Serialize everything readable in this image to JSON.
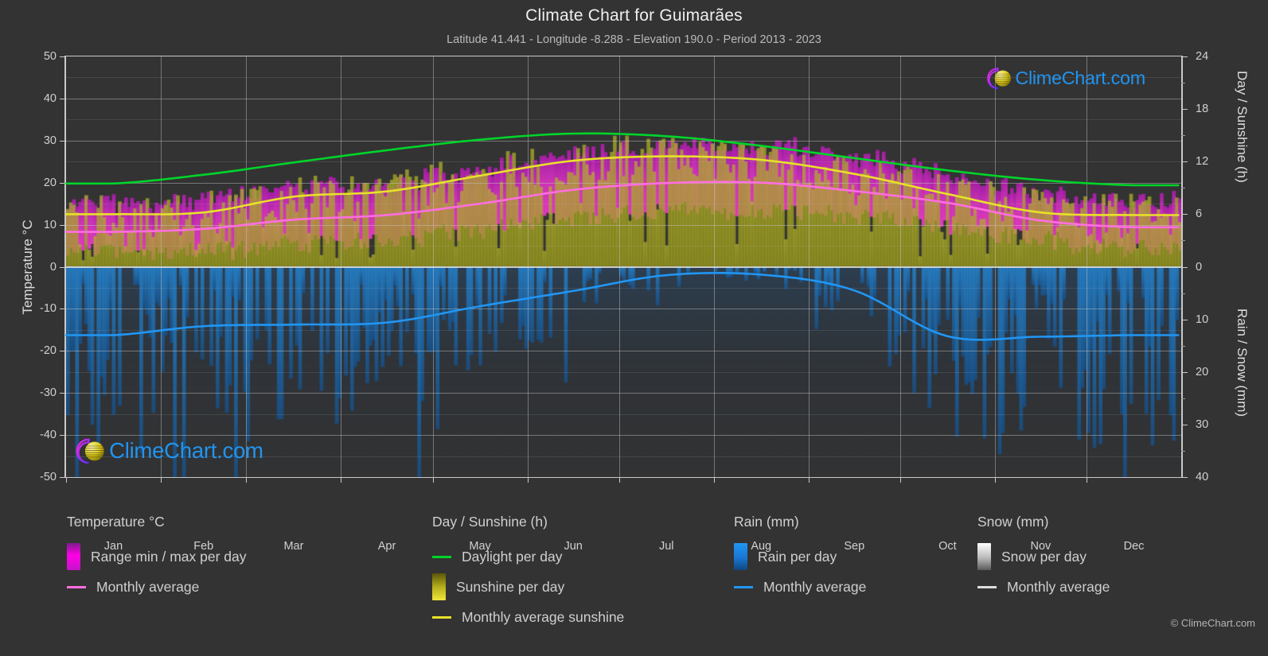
{
  "header": {
    "title": "Climate Chart for Guimarães",
    "subtitle": "Latitude 41.441 - Longitude -8.288 - Elevation 190.0 - Period 2013 - 2023"
  },
  "axes": {
    "left_title": "Temperature °C",
    "right_title_top": "Day / Sunshine (h)",
    "right_title_bottom": "Rain / Snow (mm)",
    "left_ticks": [
      "50",
      "40",
      "30",
      "20",
      "10",
      "0",
      "-10",
      "-20",
      "-30",
      "-40",
      "-50"
    ],
    "right_ticks_top": [
      "24",
      "18",
      "12",
      "6",
      "0"
    ],
    "right_ticks_bottom": [
      "0",
      "10",
      "20",
      "30",
      "40"
    ],
    "x_ticks": [
      "Jan",
      "Feb",
      "Mar",
      "Apr",
      "May",
      "Jun",
      "Jul",
      "Aug",
      "Sep",
      "Oct",
      "Nov",
      "Dec"
    ]
  },
  "branding": {
    "logo_text": "ClimeChart.com",
    "copyright": "© ClimeChart.com"
  },
  "legend": {
    "groups": [
      {
        "title": "Temperature °C",
        "items": [
          {
            "label": "Range min / max per day",
            "type": "swatch",
            "color": "#ff00e6"
          },
          {
            "label": "Monthly average",
            "type": "line",
            "color": "#ff6ee0"
          }
        ]
      },
      {
        "title": "Day / Sunshine (h)",
        "items": [
          {
            "label": "Daylight per day",
            "type": "line",
            "color": "#00d42a"
          },
          {
            "label": "Sunshine per day",
            "type": "swatch",
            "color": "#e8e12a"
          },
          {
            "label": "Monthly average sunshine",
            "type": "line",
            "color": "#e8e12a"
          }
        ]
      },
      {
        "title": "Rain (mm)",
        "items": [
          {
            "label": "Rain per day",
            "type": "swatch",
            "color": "#1f8fe0"
          },
          {
            "label": "Monthly average",
            "type": "line",
            "color": "#2196f3"
          }
        ]
      },
      {
        "title": "Snow (mm)",
        "items": [
          {
            "label": "Snow per day",
            "type": "swatch",
            "color": "#d8d8d8"
          },
          {
            "label": "Monthly average",
            "type": "line",
            "color": "#dddddd"
          }
        ]
      }
    ]
  },
  "chart_data": {
    "type": "area",
    "title": "Climate Chart for Guimarães",
    "subtitle": "Latitude 41.441 - Longitude -8.288 - Elevation 190.0 - Period 2013 - 2023",
    "location": "Guimarães",
    "latitude": 41.441,
    "longitude": -8.288,
    "elevation": 190.0,
    "period": "2013 - 2023",
    "xlabel": "",
    "x_categories": [
      "Jan",
      "Feb",
      "Mar",
      "Apr",
      "May",
      "Jun",
      "Jul",
      "Aug",
      "Sep",
      "Oct",
      "Nov",
      "Dec"
    ],
    "grid": true,
    "legend_position": "bottom",
    "left_axis": {
      "label": "Temperature °C",
      "min": -50,
      "max": 50,
      "step": 10
    },
    "right_axis_top": {
      "label": "Day / Sunshine (h)",
      "min": 0,
      "max": 24,
      "step": 6
    },
    "right_axis_bottom": {
      "label": "Rain / Snow (mm)",
      "min": 0,
      "max": 40,
      "step": 10,
      "inverted": true
    },
    "series": [
      {
        "name": "Monthly average temperature",
        "unit": "°C",
        "color": "#ff6ee0",
        "axis": "left",
        "values": [
          8.3,
          9.0,
          11.2,
          12.3,
          15.0,
          18.3,
          19.9,
          20.0,
          18.0,
          15.2,
          11.0,
          9.4
        ]
      },
      {
        "name": "Daylight per day",
        "unit": "h",
        "color": "#00d42a",
        "axis": "right_top",
        "values": [
          9.5,
          10.5,
          11.9,
          13.3,
          14.5,
          15.2,
          14.9,
          13.8,
          12.4,
          11.0,
          9.9,
          9.3
        ]
      },
      {
        "name": "Monthly average sunshine",
        "unit": "h",
        "color": "#e8e12a",
        "axis": "right_top",
        "values": [
          6.0,
          6.2,
          8.0,
          8.6,
          10.4,
          12.1,
          12.6,
          12.2,
          10.6,
          8.3,
          6.2,
          5.9
        ]
      },
      {
        "name": "Monthly average rain",
        "unit": "mm",
        "color": "#2196f3",
        "axis": "right_bottom",
        "values": [
          13.0,
          11.3,
          11.0,
          10.6,
          7.5,
          4.6,
          1.6,
          1.5,
          4.5,
          13.2,
          13.3,
          13.0
        ]
      },
      {
        "name": "Monthly average snow",
        "unit": "mm",
        "color": "#dddddd",
        "axis": "right_bottom",
        "values": [
          0,
          0,
          0,
          0,
          0,
          0,
          0,
          0,
          0,
          0,
          0,
          0
        ]
      },
      {
        "name": "Temperature range min per day",
        "unit": "°C",
        "color": "#ff00e6",
        "axis": "left",
        "values": [
          4.2,
          4.6,
          6.3,
          7.3,
          10.0,
          13.0,
          14.3,
          14.4,
          12.8,
          10.8,
          7.1,
          5.4
        ]
      },
      {
        "name": "Temperature range max per day",
        "unit": "°C",
        "color": "#ff00e6",
        "axis": "left",
        "values": [
          13.2,
          14.4,
          17.2,
          18.0,
          21.3,
          25.0,
          27.2,
          27.3,
          24.5,
          20.3,
          15.6,
          13.8
        ]
      },
      {
        "name": "Sunshine per day",
        "unit": "h",
        "color": "#e8e12a",
        "axis": "right_top",
        "values": [
          6.0,
          6.2,
          8.0,
          8.6,
          10.4,
          12.1,
          12.6,
          12.2,
          10.6,
          8.3,
          6.2,
          5.9
        ]
      },
      {
        "name": "Rain per day",
        "unit": "mm",
        "color": "#1f8fe0",
        "axis": "right_bottom",
        "values": [
          13.0,
          11.3,
          11.0,
          10.6,
          7.5,
          4.6,
          1.6,
          1.5,
          4.5,
          13.2,
          13.3,
          13.0
        ]
      }
    ]
  }
}
